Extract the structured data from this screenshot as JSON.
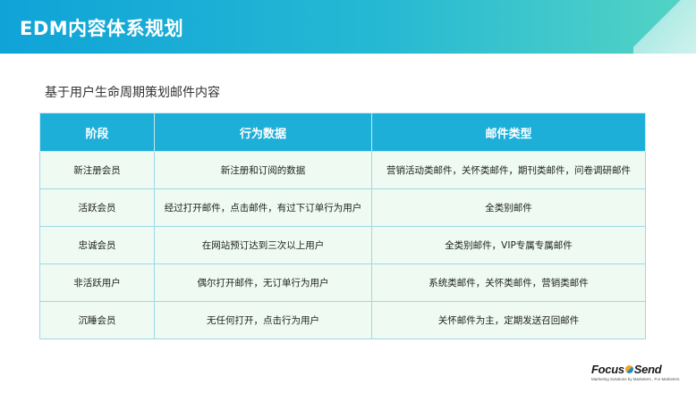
{
  "header": {
    "title": "EDM内容体系规划"
  },
  "subtitle": "基于用户生命周期策划邮件内容",
  "table": {
    "columns": [
      "阶段",
      "行为数据",
      "邮件类型"
    ],
    "rows": [
      [
        "新注册会员",
        "新注册和订阅的数据",
        "营销活动类邮件，关怀类邮件，期刊类邮件，问卷调研邮件"
      ],
      [
        "活跃会员",
        "经过打开邮件，点击邮件，有过下订单行为用户",
        "全类别邮件"
      ],
      [
        "忠诚会员",
        "在网站预订达到三次以上用户",
        "全类别邮件，VIP专属专属邮件"
      ],
      [
        "非活跃用户",
        "偶尔打开邮件，无订单行为用户",
        "系统类邮件，关怀类邮件，营销类邮件"
      ],
      [
        "沉睡会员",
        "无任何打开，点击行为用户",
        "关怀邮件为主，定期发送召回邮件"
      ]
    ]
  },
  "logo": {
    "brand_left": "Focus",
    "brand_right": "Send",
    "tagline": "Marketing Solutions by Marketers , For Marketers"
  },
  "colors": {
    "header_start": "#0fa3d8",
    "header_end": "#55d4c4",
    "table_header": "#1eafd9",
    "table_cell": "#eefaf2"
  }
}
